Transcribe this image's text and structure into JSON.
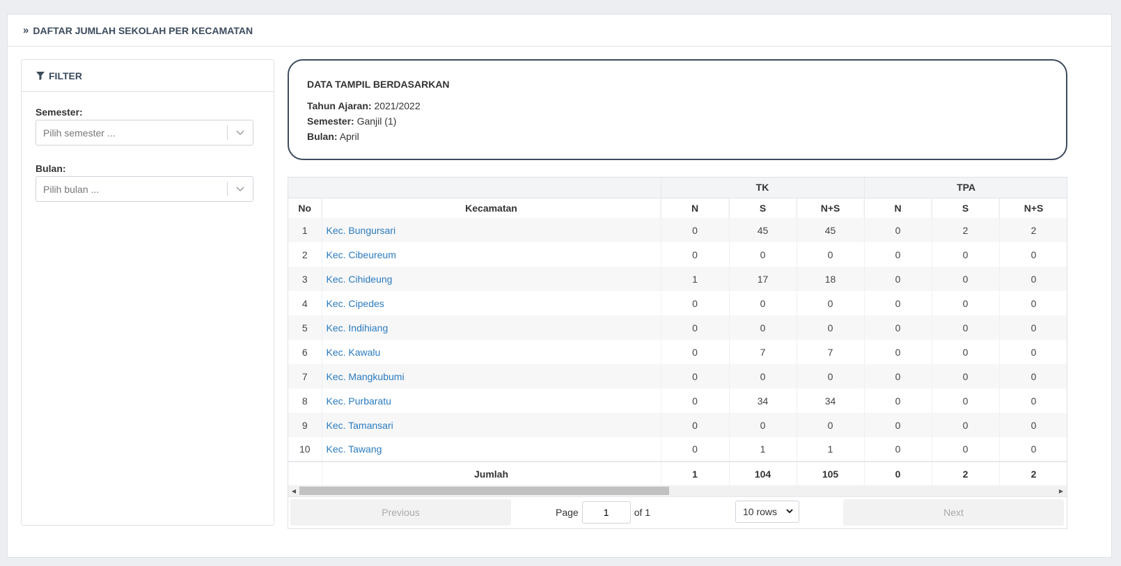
{
  "header": {
    "title": "DAFTAR JUMLAH SEKOLAH PER KECAMATAN"
  },
  "filter": {
    "title": "FILTER",
    "semester_label": "Semester:",
    "semester_placeholder": "Pilih semester ...",
    "bulan_label": "Bulan:",
    "bulan_placeholder": "Pilih bulan ..."
  },
  "info": {
    "title": "DATA TAMPIL BERDASARKAN",
    "tahun_label": "Tahun Ajaran:",
    "tahun_value": "2021/2022",
    "semester_label": "Semester:",
    "semester_value": "Ganjil (1)",
    "bulan_label": "Bulan:",
    "bulan_value": "April"
  },
  "table": {
    "groups": {
      "tk": "TK",
      "tpa": "TPA"
    },
    "headers": {
      "no": "No",
      "kecamatan": "Kecamatan",
      "n": "N",
      "s": "S",
      "ns": "N+S"
    },
    "rows": [
      {
        "no": "1",
        "kecamatan": "Kec. Bungursari",
        "tk_n": "0",
        "tk_s": "45",
        "tk_ns": "45",
        "tpa_n": "0",
        "tpa_s": "2",
        "tpa_ns": "2"
      },
      {
        "no": "2",
        "kecamatan": "Kec. Cibeureum",
        "tk_n": "0",
        "tk_s": "0",
        "tk_ns": "0",
        "tpa_n": "0",
        "tpa_s": "0",
        "tpa_ns": "0"
      },
      {
        "no": "3",
        "kecamatan": "Kec. Cihideung",
        "tk_n": "1",
        "tk_s": "17",
        "tk_ns": "18",
        "tpa_n": "0",
        "tpa_s": "0",
        "tpa_ns": "0"
      },
      {
        "no": "4",
        "kecamatan": "Kec. Cipedes",
        "tk_n": "0",
        "tk_s": "0",
        "tk_ns": "0",
        "tpa_n": "0",
        "tpa_s": "0",
        "tpa_ns": "0"
      },
      {
        "no": "5",
        "kecamatan": "Kec. Indihiang",
        "tk_n": "0",
        "tk_s": "0",
        "tk_ns": "0",
        "tpa_n": "0",
        "tpa_s": "0",
        "tpa_ns": "0"
      },
      {
        "no": "6",
        "kecamatan": "Kec. Kawalu",
        "tk_n": "0",
        "tk_s": "7",
        "tk_ns": "7",
        "tpa_n": "0",
        "tpa_s": "0",
        "tpa_ns": "0"
      },
      {
        "no": "7",
        "kecamatan": "Kec. Mangkubumi",
        "tk_n": "0",
        "tk_s": "0",
        "tk_ns": "0",
        "tpa_n": "0",
        "tpa_s": "0",
        "tpa_ns": "0"
      },
      {
        "no": "8",
        "kecamatan": "Kec. Purbaratu",
        "tk_n": "0",
        "tk_s": "34",
        "tk_ns": "34",
        "tpa_n": "0",
        "tpa_s": "0",
        "tpa_ns": "0"
      },
      {
        "no": "9",
        "kecamatan": "Kec. Tamansari",
        "tk_n": "0",
        "tk_s": "0",
        "tk_ns": "0",
        "tpa_n": "0",
        "tpa_s": "0",
        "tpa_ns": "0"
      },
      {
        "no": "10",
        "kecamatan": "Kec. Tawang",
        "tk_n": "0",
        "tk_s": "1",
        "tk_ns": "1",
        "tpa_n": "0",
        "tpa_s": "0",
        "tpa_ns": "0"
      }
    ],
    "footer": {
      "label": "Jumlah",
      "tk_n": "1",
      "tk_s": "104",
      "tk_ns": "105",
      "tpa_n": "0",
      "tpa_s": "2",
      "tpa_ns": "2"
    }
  },
  "pagination": {
    "previous": "Previous",
    "next": "Next",
    "page_label": "Page",
    "page_value": "1",
    "of_label": "of 1",
    "rows_option": "10 rows"
  },
  "colors": {
    "link": "#2a7bbf",
    "border_dark": "#3c4a5c"
  }
}
